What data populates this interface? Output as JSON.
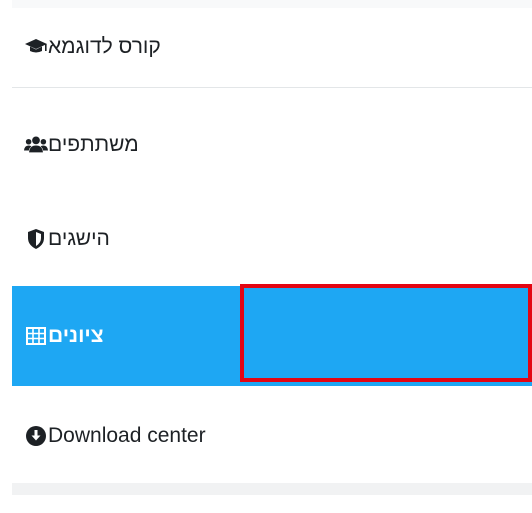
{
  "nav": {
    "items": [
      {
        "label": "קורס לדוגמא",
        "icon": "graduation-cap-icon"
      },
      {
        "label": "משתתפים",
        "icon": "users-icon"
      },
      {
        "label": "הישגים",
        "icon": "shield-icon"
      },
      {
        "label": "ציונים",
        "icon": "table-icon",
        "active": true
      },
      {
        "label": "Download center",
        "icon": "download-circle-icon"
      }
    ]
  },
  "colors": {
    "active_background": "#1ea7f3",
    "active_text": "#ffffff",
    "highlight_border": "#e30613",
    "text": "#1d2125"
  }
}
